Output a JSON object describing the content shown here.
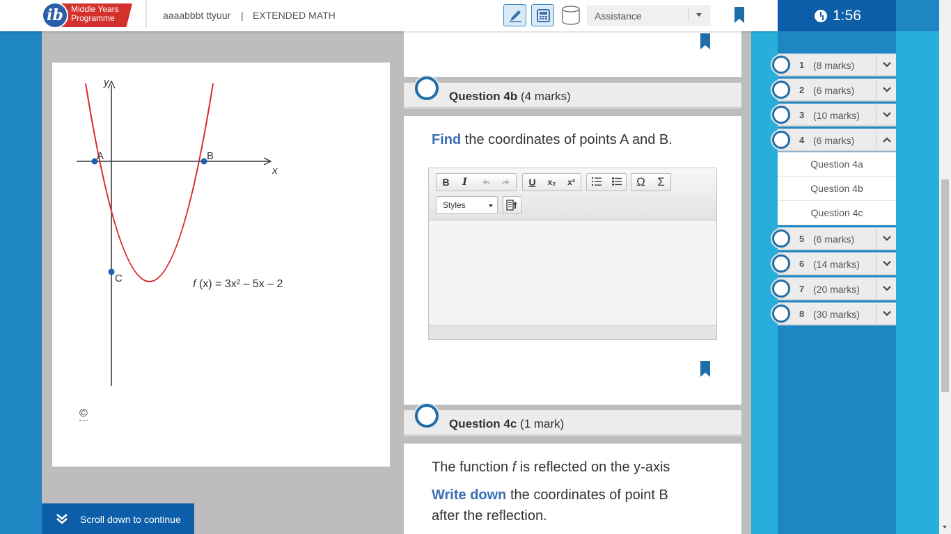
{
  "header": {
    "logo_line1": "Middle Years",
    "logo_line2": "Programme",
    "logo_letter": "ib",
    "student": "aaaabbbt ttyuur",
    "separator": "|",
    "subject": "EXTENDED MATH",
    "assistance_label": "Assistance",
    "timer": "1:56"
  },
  "figure": {
    "y_label": "y",
    "x_label": "x",
    "point_a": "A",
    "point_b": "B",
    "point_c": "C",
    "function_label_f": "f",
    "function_label_rest": " (x) = 3x² – 5x – 2",
    "copyright": "©",
    "curve_color": "#d9272e",
    "point_color": "#1f5fae"
  },
  "question_4b": {
    "title": "Question 4b",
    "marks": "(4 marks)",
    "keyword": "Find",
    "text": " the coordinates of points A and B."
  },
  "editor": {
    "bold": "B",
    "italic": "I",
    "underline": "U",
    "subscript": "x₂",
    "superscript": "x²",
    "omega": "Ω",
    "sigma": "Σ",
    "styles_label": "Styles"
  },
  "question_4c": {
    "title": "Question 4c",
    "marks": "(1 mark)",
    "line1_pre": "The function ",
    "line1_f": "f",
    "line1_post": " is reflected on the y-axis",
    "keyword": "Write down",
    "line2": " the coordinates of point B",
    "line3": "after the reflection."
  },
  "nav": {
    "items": [
      {
        "num": "1",
        "marks": "(8 marks)"
      },
      {
        "num": "2",
        "marks": "(6 marks)"
      },
      {
        "num": "3",
        "marks": "(10 marks)"
      },
      {
        "num": "4",
        "marks": "(6 marks)"
      },
      {
        "num": "5",
        "marks": "(6 marks)"
      },
      {
        "num": "6",
        "marks": "(14 marks)"
      },
      {
        "num": "7",
        "marks": "(20 marks)"
      },
      {
        "num": "8",
        "marks": "(30 marks)"
      }
    ],
    "subitems": [
      "Question 4a",
      "Question 4b",
      "Question 4c"
    ]
  },
  "scroll_cta": "Scroll down to continue",
  "colors": {
    "brand_blue": "#0c5ea8",
    "accent_blue": "#27aedb",
    "keyword_blue": "#3a6fb3",
    "ib_red": "#d3322c"
  }
}
